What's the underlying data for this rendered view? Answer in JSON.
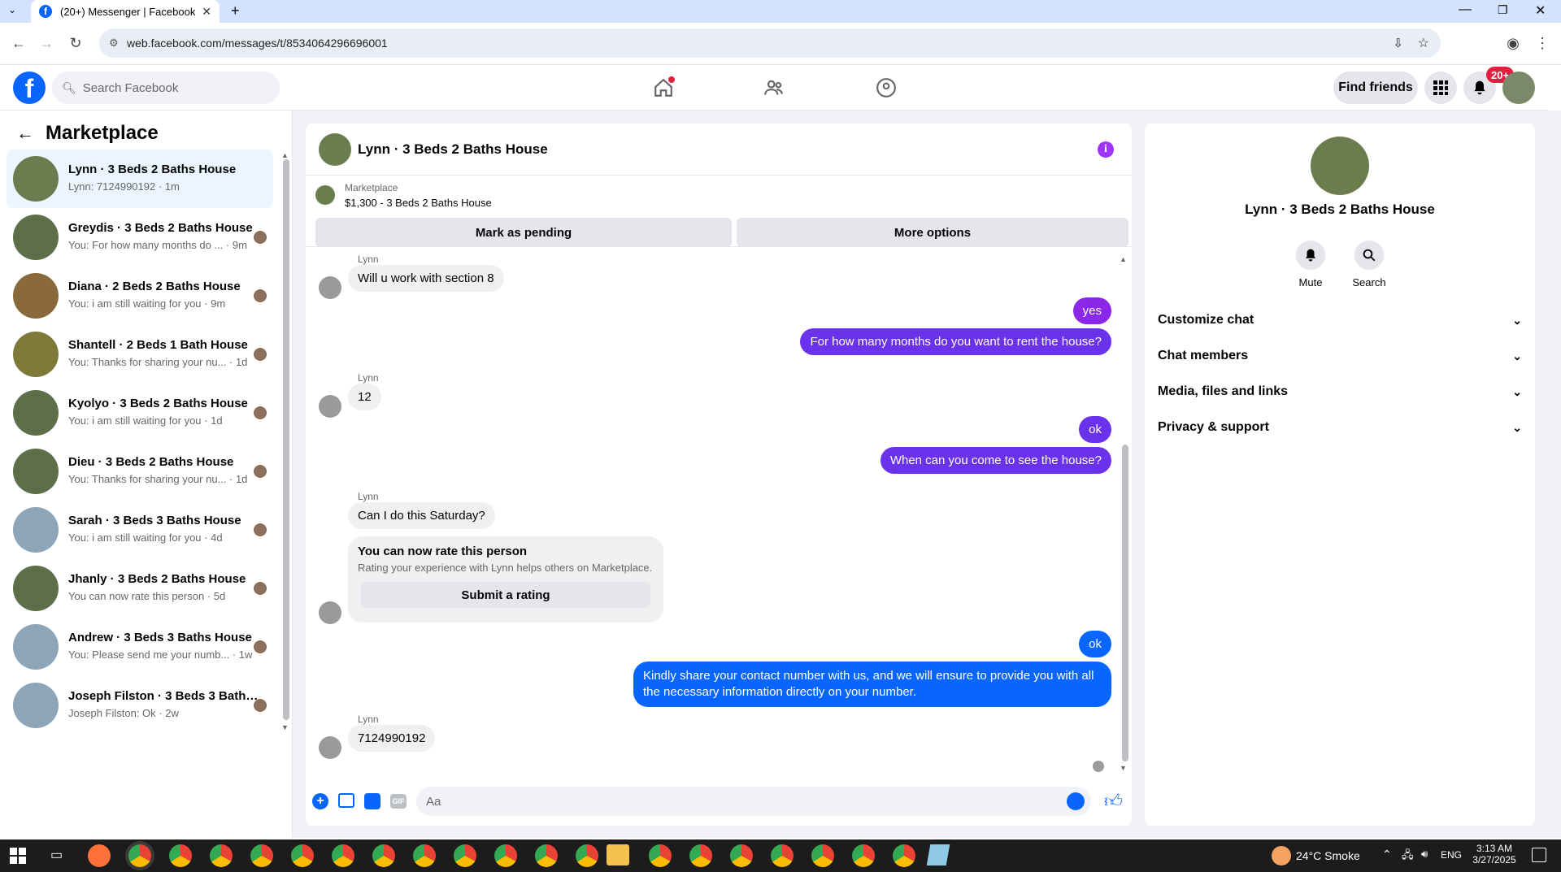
{
  "browser": {
    "tab_title": "(20+) Messenger | Facebook",
    "url": "web.facebook.com/messages/t/8534064296696001"
  },
  "header": {
    "search_placeholder": "Search Facebook",
    "find_friends": "Find friends",
    "notif_badge": "20+"
  },
  "sidebar": {
    "title": "Marketplace",
    "conversations": [
      {
        "name": "Lynn · 3 Beds 2 Baths House",
        "preview": "Lynn: 7124990192 · 1m",
        "selected": true,
        "color": "#6b7c4f"
      },
      {
        "name": "Greydis · 3 Beds 2 Baths House",
        "preview": "You: For how many months do ... · 9m",
        "color": "#5d6e48"
      },
      {
        "name": "Diana · 2 Beds 2 Baths House",
        "preview": "You: i am still waiting for you · 9m",
        "color": "#8a6a3c"
      },
      {
        "name": "Shantell · 2 Beds 1 Bath House",
        "preview": "You: Thanks for sharing your nu... · 1d",
        "color": "#7d7a3a"
      },
      {
        "name": "Kyolyo · 3 Beds 2 Baths House",
        "preview": "You: i am still waiting for you · 1d",
        "color": "#5d6e48"
      },
      {
        "name": "Dieu · 3 Beds 2 Baths House",
        "preview": "You: Thanks for sharing your nu... · 1d",
        "color": "#5d6e48"
      },
      {
        "name": "Sarah · 3 Beds 3 Baths House",
        "preview": "You: i am still waiting for you · 4d",
        "color": "#8ea6b8"
      },
      {
        "name": "Jhanly · 3 Beds 2 Baths House",
        "preview": "You can now rate this person · 5d",
        "color": "#5d6e48"
      },
      {
        "name": "Andrew · 3 Beds 3 Baths House",
        "preview": "You: Please send me your numb... · 1w",
        "color": "#8ea6b8"
      },
      {
        "name": "Joseph Filston · 3 Beds 3 Baths ...",
        "preview": "Joseph Filston: Ok · 2w",
        "color": "#8ea6b8"
      }
    ]
  },
  "chat": {
    "title": "Lynn · 3 Beds 2 Baths House",
    "marketplace_label": "Marketplace",
    "listing": "$1,300 - 3 Beds 2 Baths House",
    "mark_pending": "Mark as pending",
    "more_options": "More options",
    "sender_name": "Lynn",
    "messages": {
      "m1": "Will u work with section 8",
      "m2": "yes",
      "m3": "For how many months do you want to rent the house?",
      "m4": "12",
      "m5": "ok",
      "m6": "When can you come to see the house?",
      "m7": "Can I do this Saturday?",
      "rate_title": "You can now rate this person",
      "rate_sub": "Rating your experience with Lynn helps others on Marketplace.",
      "rate_btn": "Submit a rating",
      "m8": "ok",
      "m9": "Kindly share your contact number with us, and we will ensure to provide you with all the necessary information directly on your number.",
      "m10": "7124990192"
    },
    "composer_placeholder": "Aa"
  },
  "details": {
    "title": "Lynn · 3 Beds 2 Baths House",
    "mute": "Mute",
    "search": "Search",
    "sections": [
      "Customize chat",
      "Chat members",
      "Media, files and links",
      "Privacy & support"
    ]
  },
  "taskbar": {
    "weather": "24°C  Smoke",
    "lang": "ENG",
    "time": "3:13 AM",
    "date": "3/27/2025"
  },
  "colors": {
    "accent": "#0866ff",
    "purple": "#8b27e8",
    "selected": "#ebf5ff"
  }
}
